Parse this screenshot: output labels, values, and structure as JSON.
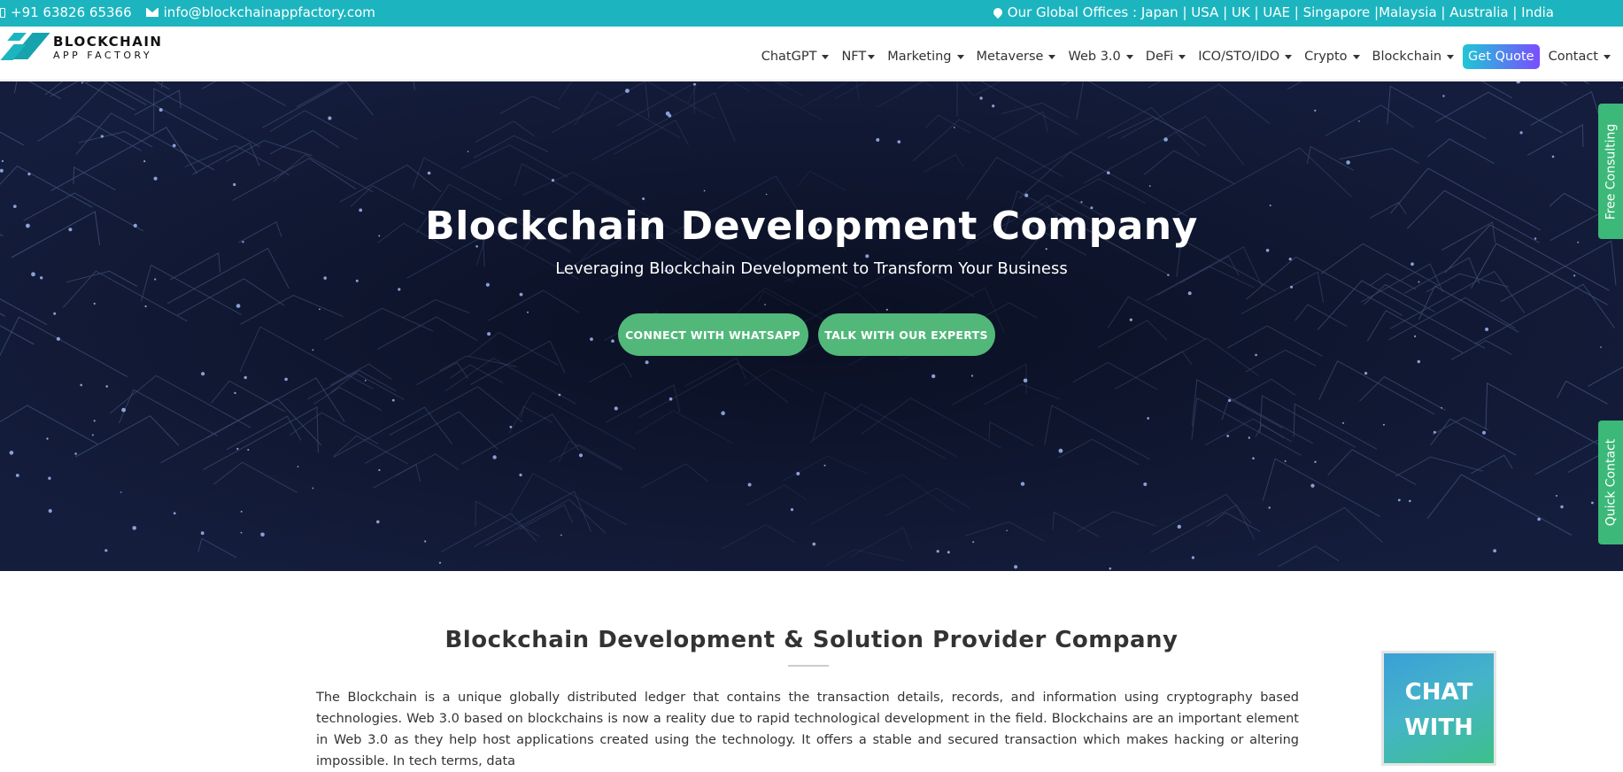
{
  "topbar": {
    "phone": "+91 63826 65366",
    "email": "info@blockchainappfactory.com",
    "offices": "Our Global Offices : Japan | USA | UK | UAE | Singapore |Malaysia | Australia | India"
  },
  "logo": {
    "line1": "BLOCKCHAIN",
    "line2": "APP FACTORY"
  },
  "nav": {
    "items": [
      "ChatGPT",
      "NFT",
      "Marketing",
      "Metaverse",
      "Web 3.0",
      "DeFi",
      "ICO/STO/IDO",
      "Crypto",
      "Blockchain"
    ],
    "get_quote": "Get Quote",
    "contact": "Contact"
  },
  "hero": {
    "title": "Blockchain Development Company",
    "subtitle": "Leveraging Blockchain Development to Transform Your Business",
    "btn_whatsapp": "CONNECT WITH WHATSAPP",
    "btn_experts": "TALK WITH OUR EXPERTS"
  },
  "side_tabs": {
    "free_consulting": "Free Consulting",
    "quick_contact": "Quick Contact"
  },
  "content": {
    "title": "Blockchain Development & Solution Provider Company",
    "paragraph": "The Blockchain is a unique globally distributed ledger that contains the transaction details, records, and information using cryptography based technologies. Web 3.0 based on blockchains is now a reality due to rapid technological development in the field. Blockchains are an important element in Web 3.0 as they help host applications created using the technology. It offers a stable and secured transaction which makes hacking or altering impossible. In tech terms, data"
  },
  "chat_widget": {
    "line1": "CHAT",
    "line2": "WITH"
  },
  "colors": {
    "topbar": "#1cb5bf",
    "hero_button": "#52b87a",
    "side_tab": "#3cb878"
  }
}
